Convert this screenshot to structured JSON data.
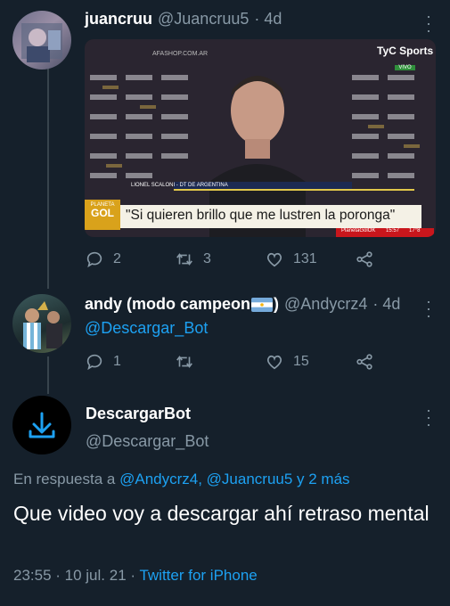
{
  "tweet1": {
    "name": "juancruu",
    "handle": "@Juancruu5",
    "time": "· 4d",
    "media": {
      "top_left_text": "AFASHOP.COM.AR",
      "channel_logo": "TyC Sports",
      "channel_live": "VIVO",
      "lower_third_name": "LIONEL SCALONI - DT DE ARGENTINA",
      "quote": "\"Si quieren brillo que me lustren la poronga\"",
      "program_tag_1": "PLANETA",
      "program_tag_2": "GOL",
      "corner_tag": "PlanetaGolOK",
      "clock": "15:57",
      "temp": "17°8"
    },
    "actions": {
      "replies": "2",
      "retweets": "3",
      "likes": "131"
    }
  },
  "tweet2": {
    "name": "andy (modo campeon",
    "name_suffix": ")",
    "handle": "@Andycrz4",
    "time": "· 4d",
    "text": "@Descargar_Bot",
    "actions": {
      "replies": "1",
      "retweets": "",
      "likes": "15"
    }
  },
  "tweet3": {
    "name": "DescargarBot",
    "handle": "@Descargar_Bot",
    "reply_prefix": "En respuesta a",
    "reply_mentions": "@Andycrz4, @Juancruu5 y 2 más",
    "text": "Que video voy a descargar ahí retraso mental",
    "time": "23:55 · 10 jul. 21 ·",
    "client": "Twitter for iPhone"
  },
  "colors": {
    "background": "#15202b",
    "secondary_text": "#8899a6",
    "link": "#1da1f2",
    "accent": "#1da1f2"
  },
  "icons": [
    "reply-icon",
    "retweet-icon",
    "like-icon",
    "share-icon",
    "download-icon",
    "more-icon",
    "argentina-flag-icon"
  ]
}
